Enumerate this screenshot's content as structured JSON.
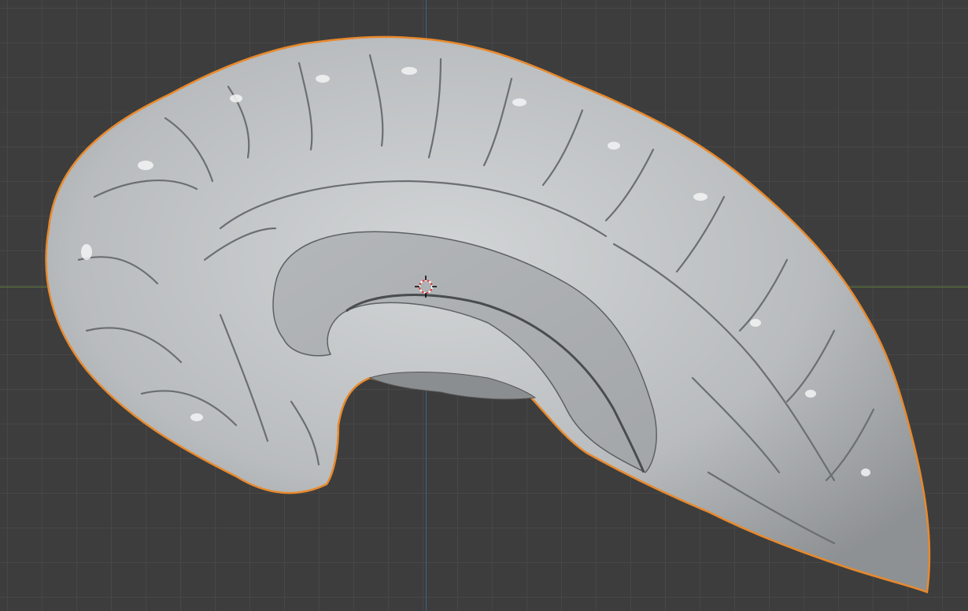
{
  "viewport": {
    "background": "#3d3d3d",
    "grid_color": "#474747",
    "x_axis_color": "#5d7a34",
    "y_axis_color": "#3f5f90"
  },
  "object": {
    "type": "brain-hemisphere-mesh",
    "selected": true,
    "selection_outline_color": "#e8892c",
    "material_color": "#c4c7c8"
  },
  "cursor_3d": {
    "colors": [
      "#e04040",
      "#ffffff",
      "#000000"
    ]
  }
}
